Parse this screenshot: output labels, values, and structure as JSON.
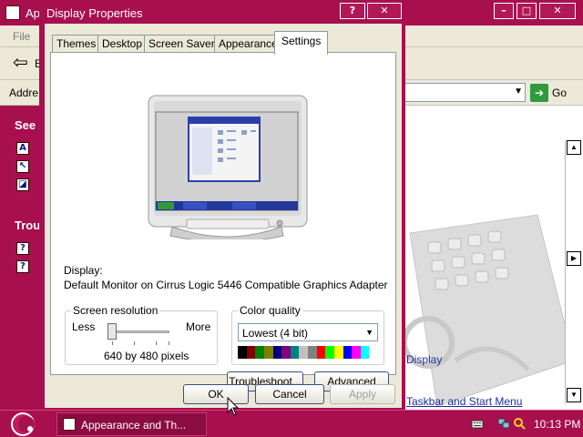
{
  "background_window": {
    "title": "Ap",
    "menu": {
      "file": "File"
    },
    "back_letter": "E",
    "address_label": "Addre",
    "go_label": "Go",
    "sidebar": {
      "see_also": "See A",
      "troubleshooters": "Trou"
    },
    "links": {
      "display": "Display",
      "taskbar": "Taskbar and Start Menu"
    }
  },
  "dialog": {
    "title": "Display Properties",
    "tabs": [
      {
        "label": "Themes"
      },
      {
        "label": "Desktop"
      },
      {
        "label": "Screen Saver"
      },
      {
        "label": "Appearance"
      },
      {
        "label": "Settings"
      }
    ],
    "active_tab": "Settings",
    "display_label": "Display:",
    "display_value": "Default Monitor on Cirrus Logic 5446 Compatible Graphics Adapter",
    "screen_resolution": {
      "legend": "Screen resolution",
      "less": "Less",
      "more": "More",
      "value_text": "640 by 480 pixels",
      "slider_position": 0
    },
    "color_quality": {
      "legend": "Color quality",
      "selected": "Lowest (4 bit)",
      "palette": [
        "#000000",
        "#800000",
        "#008000",
        "#808000",
        "#000080",
        "#800080",
        "#008080",
        "#c0c0c0",
        "#808080",
        "#ff0000",
        "#00ff00",
        "#ffff00",
        "#0000ff",
        "#ff00ff",
        "#00ffff",
        "#ffffff"
      ]
    },
    "buttons": {
      "troubleshoot": "Troubleshoot...",
      "advanced": "Advanced",
      "ok": "OK",
      "cancel": "Cancel",
      "apply": "Apply"
    }
  },
  "taskbar": {
    "task_label": "Appearance and Th...",
    "clock": "10:13 PM"
  },
  "colors": {
    "theme": "#a80f4e",
    "dialog_face": "#ece9d8",
    "link": "#1a2ea0"
  }
}
